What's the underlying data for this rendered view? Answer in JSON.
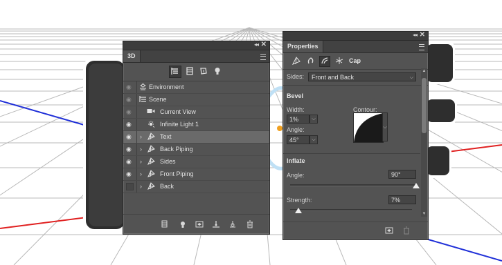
{
  "colors": {
    "panel_bg": "#535353",
    "selected_row": "#6a6a6a",
    "axis_red": "#e02020",
    "axis_blue": "#2030d8"
  },
  "panel_3d": {
    "tab_title": "3D",
    "filter_icons": [
      "whole-scene-filter-icon",
      "meshes-filter-icon",
      "materials-filter-icon",
      "lights-filter-icon"
    ],
    "layers": [
      {
        "name": "Environment",
        "icon": "environment-icon",
        "visible": "dim"
      },
      {
        "name": "Scene",
        "icon": "scene-icon",
        "visible": "dim"
      },
      {
        "name": "Current View",
        "icon": "camera-icon",
        "visible": "dim"
      },
      {
        "name": "Infinite Light 1",
        "icon": "light-icon",
        "visible": "on"
      },
      {
        "name": "Text",
        "icon": "mesh-icon",
        "visible": "on",
        "selected": "true"
      },
      {
        "name": "Back Piping",
        "icon": "mesh-icon",
        "visible": "on"
      },
      {
        "name": "Sides",
        "icon": "mesh-icon",
        "visible": "on"
      },
      {
        "name": "Front Piping",
        "icon": "mesh-icon",
        "visible": "on"
      },
      {
        "name": "Back",
        "icon": "mesh-icon",
        "visible": "off"
      }
    ]
  },
  "panel_props": {
    "tab_title": "Properties",
    "cap_label": "Cap",
    "sides_label": "Sides:",
    "sides_value": "Front and Back",
    "bevel_header": "Bevel",
    "width_label": "Width:",
    "width_value": "1%",
    "contour_label": "Contour:",
    "angle_label": "Angle:",
    "bevel_angle_value": "45°",
    "inflate_header": "Inflate",
    "inflate_angle_label": "Angle:",
    "inflate_angle_value": "90°",
    "inflate_angle_level": 1.0,
    "strength_label": "Strength:",
    "strength_value": "7%",
    "strength_level": 0.07
  },
  "glyphs": {
    "collapse": "◂◂",
    "close": "✕",
    "chevron": "›",
    "dropdown": "⌵"
  }
}
